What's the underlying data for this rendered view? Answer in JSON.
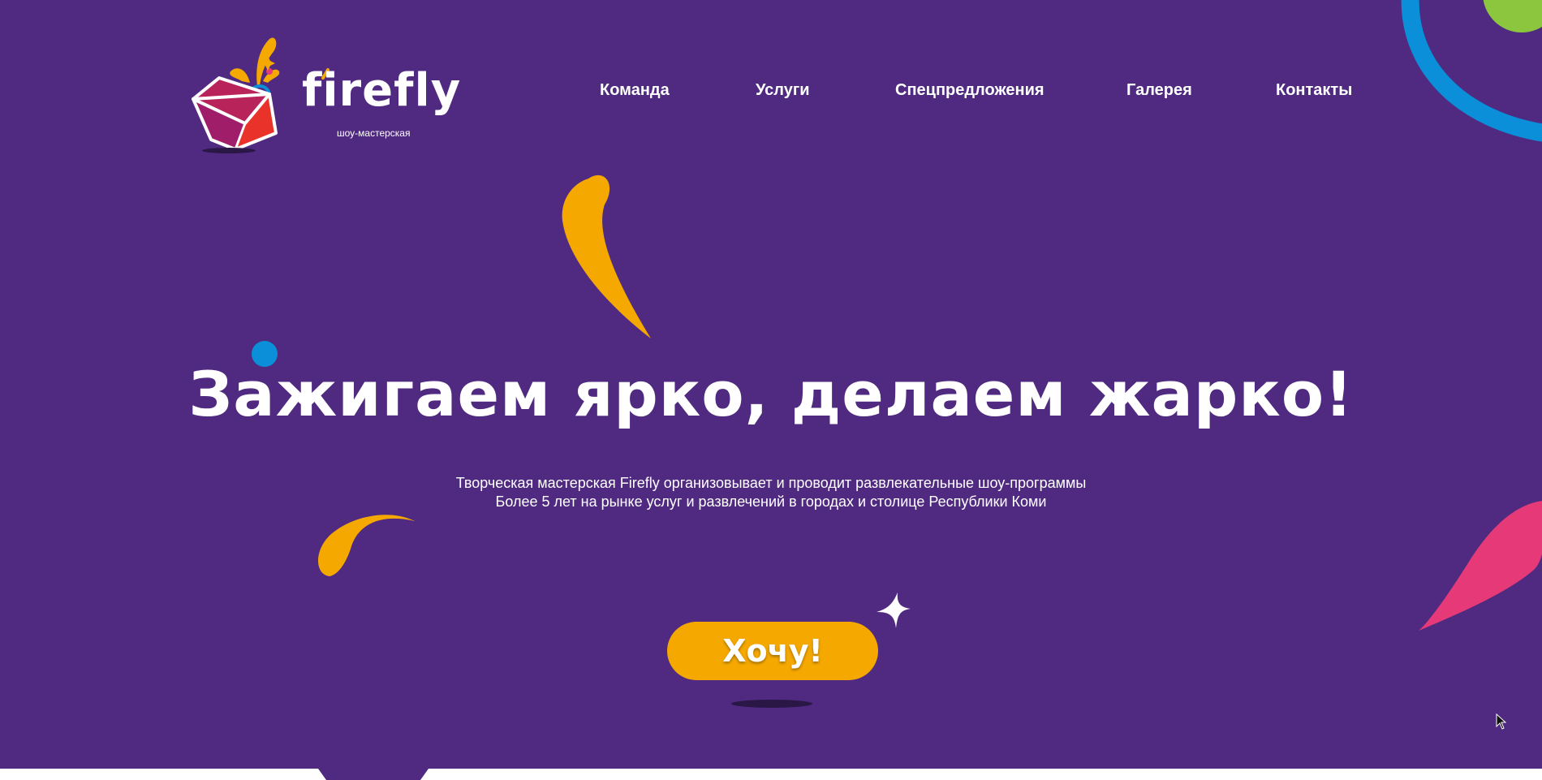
{
  "brand": {
    "name": "firefly",
    "tagline": "шоу-мастерская"
  },
  "nav": {
    "items": [
      {
        "label": "Команда"
      },
      {
        "label": "Услуги"
      },
      {
        "label": "Спецпредложения"
      },
      {
        "label": "Галерея"
      },
      {
        "label": "Контакты"
      }
    ]
  },
  "hero": {
    "headline": "Зажигаем ярко, делаем жарко!",
    "description_line1": "Творческая мастерская Firefly организовывает и проводит развлекательные шоу-программы",
    "description_line2": "Более 5 лет на рынке услуг и развлечений в городах и столице Республики Коми",
    "cta_label": "Хочу!"
  },
  "colors": {
    "background": "#4f2a80",
    "accent_yellow": "#f5a800",
    "accent_blue": "#0a8fd8",
    "accent_pink": "#e63a78",
    "accent_green": "#8cc63f",
    "text": "#ffffff"
  },
  "icons": {
    "logo": "gift-box-logo-icon",
    "cursor": "mouse-pointer-icon"
  }
}
